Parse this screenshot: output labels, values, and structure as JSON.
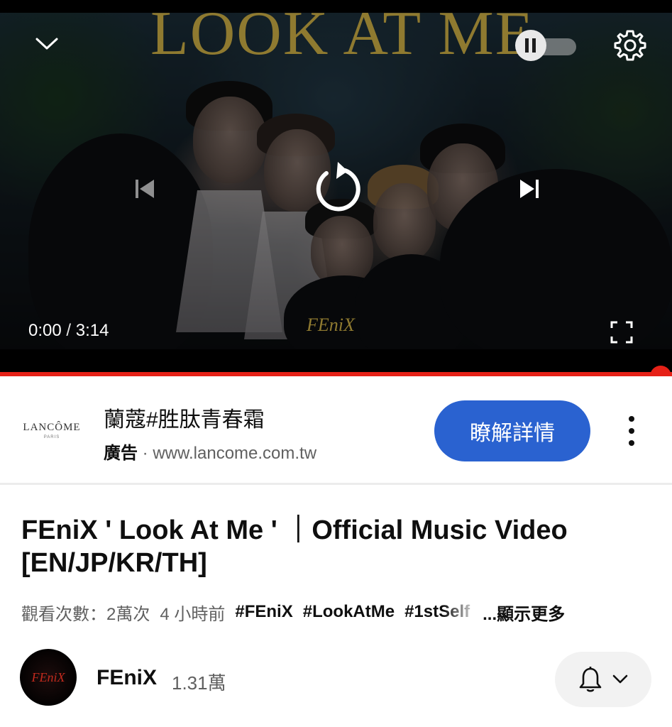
{
  "player": {
    "video_title_overlay": "LOOK AT ME",
    "overlay_logo": "FEniX",
    "current_time": "0:00",
    "time_separator": "/",
    "duration": "3:14",
    "progress_fraction": 1.0,
    "autoplay": "on",
    "icons": [
      "chevron-down-icon",
      "pause-icon",
      "gear-icon",
      "skip-previous-icon",
      "replay-icon",
      "skip-next-icon",
      "fullscreen-icon"
    ],
    "accent_color": "#e62117"
  },
  "ad": {
    "logo_text": "LANCÔME",
    "logo_subtext": "PARIS",
    "title": "蘭蔻#胜肽青春霜",
    "ad_label": "廣告",
    "separator": " · ",
    "url": "www.lancome.com.tw",
    "cta_label": "瞭解詳情",
    "cta_color": "#2a62d0",
    "more_icon": "more-vert-icon"
  },
  "video": {
    "title": "FEniX ' Look At Me ' ｜Official Music Video [EN/JP/KR/TH]",
    "views": "觀看次數：2萬次",
    "age": "4 小時前",
    "tags": [
      "#FEniX",
      "#LookAtMe",
      "#1stSelf"
    ],
    "show_more": "...顯示更多"
  },
  "channel": {
    "avatar_text": "FEniX",
    "name": "FEniX",
    "subscribers": "1.31萬",
    "bell_icon": "bell-icon",
    "dropdown_icon": "chevron-down-icon"
  }
}
